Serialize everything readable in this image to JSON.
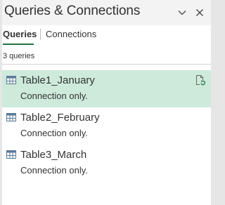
{
  "pane": {
    "title": "Queries & Connections",
    "collapse_icon": "chevron-down-icon",
    "close_icon": "close-icon"
  },
  "tabs": [
    {
      "label": "Queries",
      "active": true
    },
    {
      "label": "Connections",
      "active": false
    }
  ],
  "query_count": "3 queries",
  "queries": [
    {
      "name": "Table1_January",
      "status": "Connection only.",
      "icon": "table-icon",
      "selected": true,
      "action_icon": "refresh-document-icon"
    },
    {
      "name": "Table2_February",
      "status": "Connection only.",
      "icon": "table-icon",
      "selected": false
    },
    {
      "name": "Table3_March",
      "status": "Connection only.",
      "icon": "table-icon",
      "selected": false
    }
  ],
  "colors": {
    "accent": "#217346",
    "selected_background": "#cdeadb",
    "header_background": "#f3f3f3"
  }
}
